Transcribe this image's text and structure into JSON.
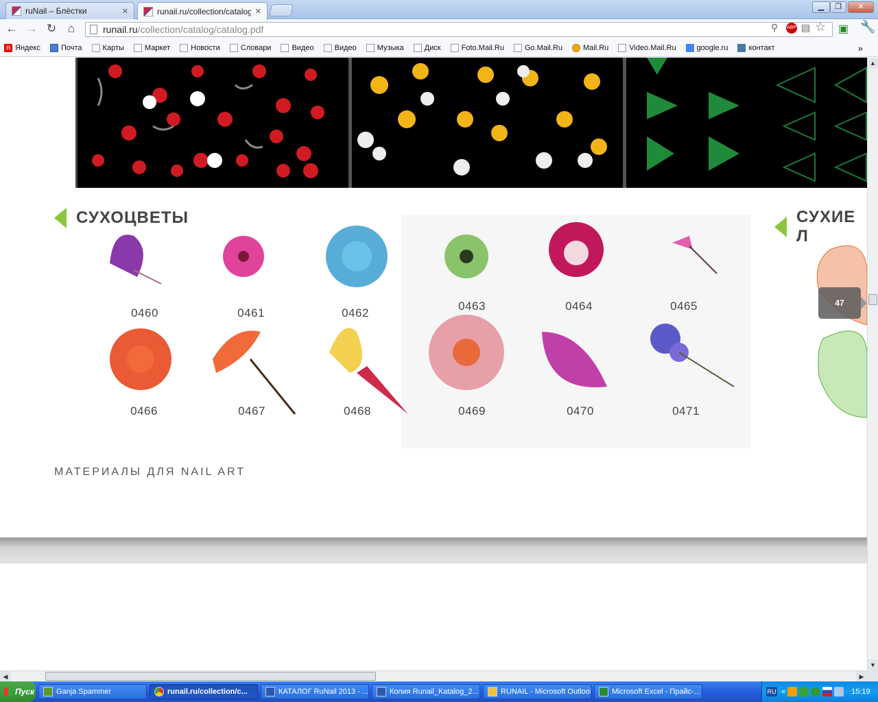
{
  "tabs": [
    {
      "label": "ruNail – Блёстки",
      "active": false
    },
    {
      "label": "runail.ru/collection/catalog/c",
      "active": true
    }
  ],
  "address": {
    "host": "runail.ru",
    "path": "/collection/catalog/catalog.pdf"
  },
  "bookmarks": [
    "Яндекс",
    "Почта",
    "Карты",
    "Маркет",
    "Новости",
    "Словари",
    "Видео",
    "Видео",
    "Музыка",
    "Диск",
    "Foto.Mail.Ru",
    "Go.Mail.Ru",
    "Mail.Ru",
    "Video.Mail.Ru",
    "google.ru",
    "контакт"
  ],
  "section_left": "СУХОЦВЕТЫ",
  "section_right": "СУХИЕ Л",
  "flowers_row1": [
    "0460",
    "0461",
    "0462",
    "0463",
    "0464",
    "0465"
  ],
  "flowers_row2": [
    "0466",
    "0467",
    "0468",
    "0469",
    "0470",
    "0471"
  ],
  "footer_text": "МАТЕРИАЛЫ ДЛЯ NAIL ART",
  "page_number": "47",
  "taskbar": {
    "start": "Пуск",
    "items": [
      "Ganja Spammer",
      "runail.ru/collection/c...",
      "КАТАЛОГ RuNail 2013 - ...",
      "Копия Runail_Katalog_2...",
      "RUNAIL - Microsoft Outlook",
      "Microsoft Excel - Прайс-..."
    ],
    "lang": "RU",
    "clock": "15:19"
  },
  "colors": {
    "accent_green": "#8cc63e",
    "taskbar_blue": "#245edb"
  }
}
